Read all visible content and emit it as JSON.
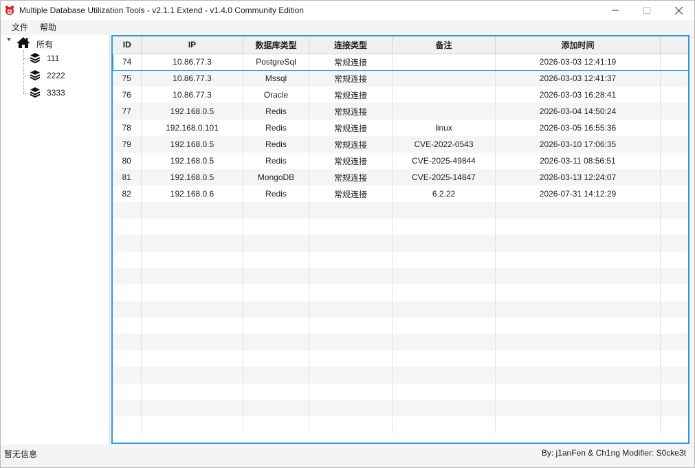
{
  "window": {
    "title": "Multiple Database Utilization Tools - v2.1.1 Extend - v1.4.0 Community Edition",
    "app_icon": "red-bug-logo-icon",
    "controls": [
      "minimize-icon",
      "maximize-icon",
      "close-icon"
    ]
  },
  "menu": {
    "items": [
      {
        "label": "文件"
      },
      {
        "label": "帮助"
      }
    ]
  },
  "tree": {
    "root": {
      "label": "所有",
      "icon": "home-icon"
    },
    "children": [
      {
        "label": "111",
        "icon": "layers-icon"
      },
      {
        "label": "2222",
        "icon": "layers-icon"
      },
      {
        "label": "3333",
        "icon": "layers-icon"
      }
    ]
  },
  "table": {
    "columns": [
      "ID",
      "IP",
      "数据库类型",
      "连接类型",
      "备注",
      "添加时间",
      ""
    ],
    "rows": [
      {
        "id": "74",
        "ip": "10.86.77.3",
        "db_type": "PostgreSql",
        "conn_type": "常规连接",
        "note": "",
        "added": "2026-03-03 12:41:19"
      },
      {
        "id": "75",
        "ip": "10.86.77.3",
        "db_type": "Mssql",
        "conn_type": "常规连接",
        "note": "",
        "added": "2026-03-03 12:41:37"
      },
      {
        "id": "76",
        "ip": "10.86.77.3",
        "db_type": "Oracle",
        "conn_type": "常规连接",
        "note": "",
        "added": "2026-03-03 16:28:41"
      },
      {
        "id": "77",
        "ip": "192.168.0.5",
        "db_type": "Redis",
        "conn_type": "常规连接",
        "note": "",
        "added": "2026-03-04 14:50:24"
      },
      {
        "id": "78",
        "ip": "192.168.0.101",
        "db_type": "Redis",
        "conn_type": "常规连接",
        "note": "linux",
        "added": "2026-03-05 16:55:36"
      },
      {
        "id": "79",
        "ip": "192.168.0.5",
        "db_type": "Redis",
        "conn_type": "常规连接",
        "note": "CVE-2022-0543",
        "added": "2026-03-10 17:06:35"
      },
      {
        "id": "80",
        "ip": "192.168.0.5",
        "db_type": "Redis",
        "conn_type": "常规连接",
        "note": "CVE-2025-49844",
        "added": "2026-03-11 08:56:51"
      },
      {
        "id": "81",
        "ip": "192.168.0.5",
        "db_type": "MongoDB",
        "conn_type": "常规连接",
        "note": "CVE-2025-14847",
        "added": "2026-03-13 12:24:07"
      },
      {
        "id": "82",
        "ip": "192.168.0.6",
        "db_type": "Redis",
        "conn_type": "常规连接",
        "note": "6.2.22",
        "added": "2026-07-31 14:12:29"
      }
    ],
    "selected_row": 0
  },
  "status": {
    "left": "暂无信息",
    "right": "By: j1anFen & Ch1ng Modifier: S0cke3t"
  },
  "colors": {
    "accent": "#2d9ad8",
    "logo": "#d9232e"
  }
}
